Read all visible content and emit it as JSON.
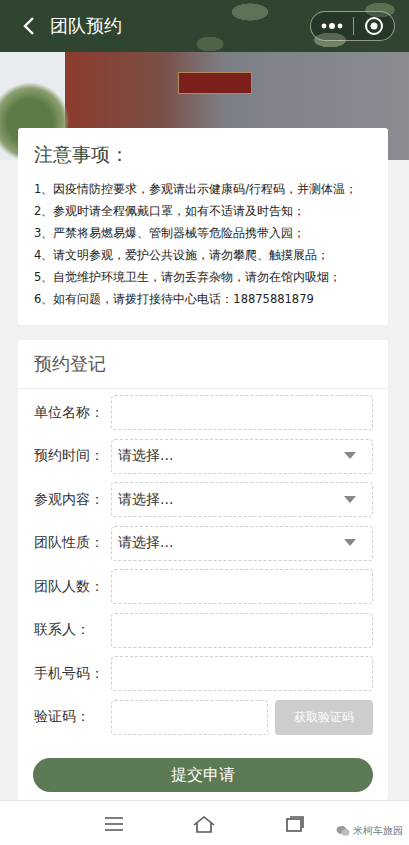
{
  "nav": {
    "title": "团队预约"
  },
  "notice": {
    "title": "注意事项：",
    "items": [
      "1、因疫情防控要求，参观请出示健康码/行程码，并测体温；",
      "2、参观时请全程佩戴口罩，如有不适请及时告知；",
      "3、严禁将易燃易爆、管制器械等危险品携带入园；",
      "4、请文明参观，爱护公共设施，请勿攀爬、触摸展品；",
      "5、自觉维护环境卫生，请勿丢弃杂物，请勿在馆内吸烟；",
      "6、如有问题，请拨打接待中心电话：18875881879"
    ]
  },
  "form": {
    "title": "预约登记",
    "fields": [
      {
        "label": "单位名称：",
        "kind": "input"
      },
      {
        "label": "预约时间：",
        "kind": "select",
        "placeholder": "请选择..."
      },
      {
        "label": "参观内容：",
        "kind": "select",
        "placeholder": "请选择..."
      },
      {
        "label": "团队性质：",
        "kind": "select",
        "placeholder": "请选择..."
      },
      {
        "label": "团队人数：",
        "kind": "input"
      },
      {
        "label": "联系人：",
        "kind": "input"
      },
      {
        "label": "手机号码：",
        "kind": "input"
      },
      {
        "label": "验证码：",
        "kind": "code",
        "button": "获取验证码",
        "disabled": true
      }
    ],
    "submit": "提交申请"
  },
  "watermark": "米柯车旅园"
}
